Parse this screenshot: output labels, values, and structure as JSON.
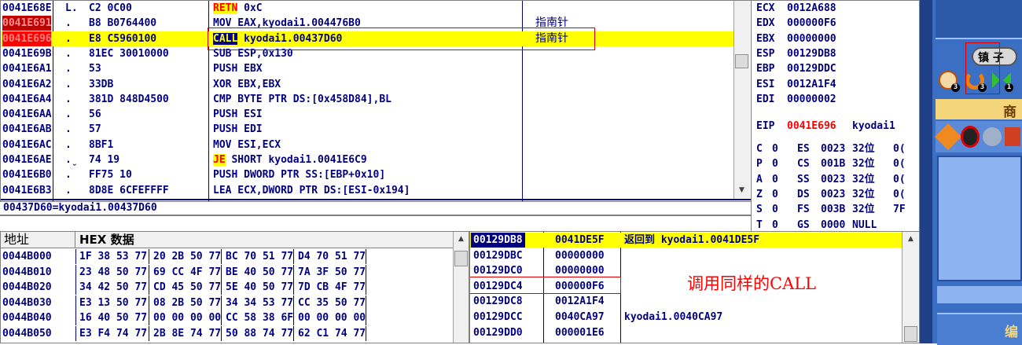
{
  "disasm": {
    "rows": [
      {
        "addr": "0041E68E",
        "mark": "L.",
        "bytes": "C2 0C00",
        "instr_kw": "RETN",
        "instr_rest": " 0xC",
        "comment": ""
      },
      {
        "addr": "0041E691",
        "mark": ".",
        "bytes": "B8 B0764400",
        "instr_kw": "",
        "instr_rest": "MOV EAX,kyodai1.004476B0",
        "comment": "指南针"
      },
      {
        "addr": "0041E696",
        "mark": ".",
        "bytes": "E8 C5960100",
        "instr_kw": "CALL",
        "instr_rest": " kyodai1.00437D60",
        "comment": "指南针"
      },
      {
        "addr": "0041E69B",
        "mark": ".",
        "bytes": "81EC 30010000",
        "instr_kw": "",
        "instr_rest": "SUB ESP,0x130",
        "comment": ""
      },
      {
        "addr": "0041E6A1",
        "mark": ".",
        "bytes": "53",
        "instr_kw": "",
        "instr_rest": "PUSH EBX",
        "comment": ""
      },
      {
        "addr": "0041E6A2",
        "mark": ".",
        "bytes": "33DB",
        "instr_kw": "",
        "instr_rest": "XOR EBX,EBX",
        "comment": ""
      },
      {
        "addr": "0041E6A4",
        "mark": ".",
        "bytes": "381D 848D4500",
        "instr_kw": "",
        "instr_rest": "CMP BYTE PTR DS:[0x458D84],BL",
        "comment": ""
      },
      {
        "addr": "0041E6AA",
        "mark": ".",
        "bytes": "56",
        "instr_kw": "",
        "instr_rest": "PUSH ESI",
        "comment": ""
      },
      {
        "addr": "0041E6AB",
        "mark": ".",
        "bytes": "57",
        "instr_kw": "",
        "instr_rest": "PUSH EDI",
        "comment": ""
      },
      {
        "addr": "0041E6AC",
        "mark": ".",
        "bytes": "8BF1",
        "instr_kw": "",
        "instr_rest": "MOV ESI,ECX",
        "comment": ""
      },
      {
        "addr": "0041E6AE",
        "mark": ".ˬ",
        "bytes": "74 19",
        "instr_kw": "JE",
        "instr_rest": " SHORT kyodai1.0041E6C9",
        "comment": ""
      },
      {
        "addr": "0041E6B0",
        "mark": ".",
        "bytes": "FF75 10",
        "instr_kw": "",
        "instr_rest": "PUSH DWORD PTR SS:[EBP+0x10]",
        "comment": ""
      },
      {
        "addr": "0041E6B3",
        "mark": ".",
        "bytes": "8D8E 6CFEFFFF",
        "instr_kw": "",
        "instr_rest": "LEA ECX,DWORD PTR DS:[ESI-0x194]",
        "comment": ""
      }
    ],
    "info_line": "00437D60=kyodai1.00437D60"
  },
  "registers": {
    "lines": [
      {
        "name": "ECX",
        "value": "0012A688"
      },
      {
        "name": "EDX",
        "value": "000000F6"
      },
      {
        "name": "EBX",
        "value": "00000000"
      },
      {
        "name": "ESP",
        "value": "00129DB8"
      },
      {
        "name": "EBP",
        "value": "00129DDC"
      },
      {
        "name": "ESI",
        "value": "0012A1F4"
      },
      {
        "name": "EDI",
        "value": "00000002"
      }
    ],
    "eip": {
      "name": "EIP",
      "value": "0041E696",
      "label": "kyodai1"
    },
    "flags": [
      {
        "f": "C",
        "v": "0",
        "seg": "ES",
        "sv": "0023",
        "bits": "32位",
        "tail": "0("
      },
      {
        "f": "P",
        "v": "0",
        "seg": "CS",
        "sv": "001B",
        "bits": "32位",
        "tail": "0("
      },
      {
        "f": "A",
        "v": "0",
        "seg": "SS",
        "sv": "0023",
        "bits": "32位",
        "tail": "0("
      },
      {
        "f": "Z",
        "v": "0",
        "seg": "DS",
        "sv": "0023",
        "bits": "32位",
        "tail": "0("
      },
      {
        "f": "S",
        "v": "0",
        "seg": "FS",
        "sv": "003B",
        "bits": "32位",
        "tail": "7F"
      },
      {
        "f": "T",
        "v": "0",
        "seg": "GS",
        "sv": "0000",
        "bits": "NULL",
        "tail": ""
      }
    ]
  },
  "dump": {
    "header_addr": "地址",
    "header_hex": "HEX 数据",
    "rows": [
      {
        "addr": "0044B000",
        "g": [
          "1F 38 53 77",
          "20 2B 50 77",
          "BC 70 51 77",
          "D4 70 51 77"
        ]
      },
      {
        "addr": "0044B010",
        "g": [
          "23 48 50 77",
          "69 CC 4F 77",
          "BE 40 50 77",
          "7A 3F 50 77"
        ]
      },
      {
        "addr": "0044B020",
        "g": [
          "34 42 50 77",
          "CD 45 50 77",
          "5E 40 50 77",
          "7D CB 4F 77"
        ]
      },
      {
        "addr": "0044B030",
        "g": [
          "E3 13 50 77",
          "08 2B 50 77",
          "34 34 53 77",
          "CC 35 50 77"
        ]
      },
      {
        "addr": "0044B040",
        "g": [
          "16 40 50 77",
          "00 00 00 00",
          "CC 58 38 6F",
          "00 00 00 00"
        ]
      },
      {
        "addr": "0044B050",
        "g": [
          "E3 F4 74 77",
          "2B 8E 74 77",
          "50 88 74 77",
          "62 C1 74 77"
        ]
      }
    ]
  },
  "stack": {
    "rows": [
      {
        "addr": "00129DB8",
        "val": "0041DE5F",
        "comment": "返回到 kyodai1.0041DE5F"
      },
      {
        "addr": "00129DBC",
        "val": "00000000",
        "comment": ""
      },
      {
        "addr": "00129DC0",
        "val": "00000000",
        "comment": ""
      },
      {
        "addr": "00129DC4",
        "val": "000000F6",
        "comment": ""
      },
      {
        "addr": "00129DC8",
        "val": "0012A1F4",
        "comment": ""
      },
      {
        "addr": "00129DCC",
        "val": "0040CA97",
        "comment": "kyodai1.0040CA97"
      },
      {
        "addr": "00129DD0",
        "val": "000001E6",
        "comment": ""
      }
    ],
    "annotation": "调用同样的CALL"
  },
  "game_panel": {
    "tool_label": "镇 子",
    "shop_char": "商",
    "bottom_char": "编",
    "counts": [
      "3",
      "3",
      "1"
    ]
  },
  "colors": {
    "selected_row_bg": "#ffff00",
    "breakpoint_bg": "#ff0000",
    "breakpoint_text": "#ff8080",
    "code_text": "#000080",
    "annotation_red": "#ff0000",
    "game_blue": "#3a6fc4"
  }
}
